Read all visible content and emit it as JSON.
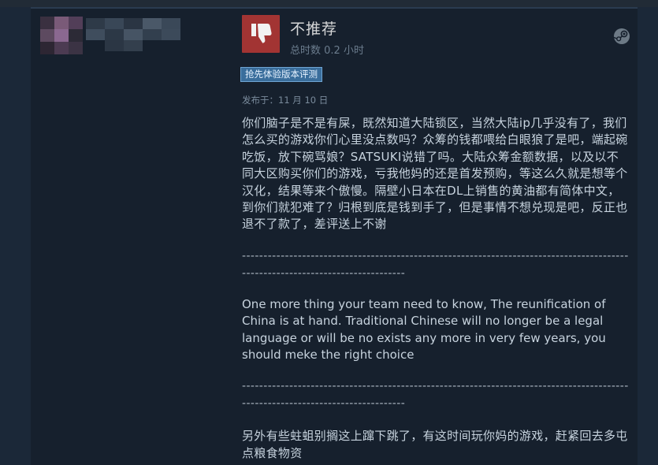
{
  "review": {
    "verdict": "不推荐",
    "hours": "总时数 0.2 小时",
    "badge": "抢先体验版本评测",
    "posted": "发布于：11 月 10 日",
    "paragraph1": "你们脑子是不是有屎，既然知道大陆锁区，当然大陆ip几乎没有了，我们怎么买的游戏你们心里没点数吗？众筹的钱都喂给白眼狼了是吧，端起碗吃饭，放下碗骂娘？SATSUKI说错了吗。大陆众筹金额数据，以及以不同大区购买你们的游戏，亏我他妈的还是首发预购，等这么久就是想等个汉化，结果等来个傲慢。隔壁小日本在DL上销售的黄油都有简体中文，到你们就犯难了？归根到底是钱到手了，但是事情不想兑现是吧，反正也退不了款了，差评送上不谢",
    "separator1": "--------------------------------------------------------------------------------------------------------------------------------",
    "paragraph2": "One more thing your team need to know, The reunification of China is at hand. Traditional Chinese will no longer be a legal language or will be no exists any more in very few years, you should meke the right choice",
    "separator2": "--------------------------------------------------------------------------------------------------------------------------------",
    "paragraph3": "另外有些蛀蛆别搁这上蹿下跳了，有这时间玩你妈的游戏，赶紧回去多屯点粮食物资"
  },
  "icons": {
    "thumb": "thumbs-down-icon",
    "platform": "steam-icon"
  },
  "colors": {
    "background": "#1b2838",
    "card": "#16202d",
    "thumb_bg": "#a23433",
    "badge_bg": "#3a6e9c",
    "text": "#c7d3de"
  }
}
